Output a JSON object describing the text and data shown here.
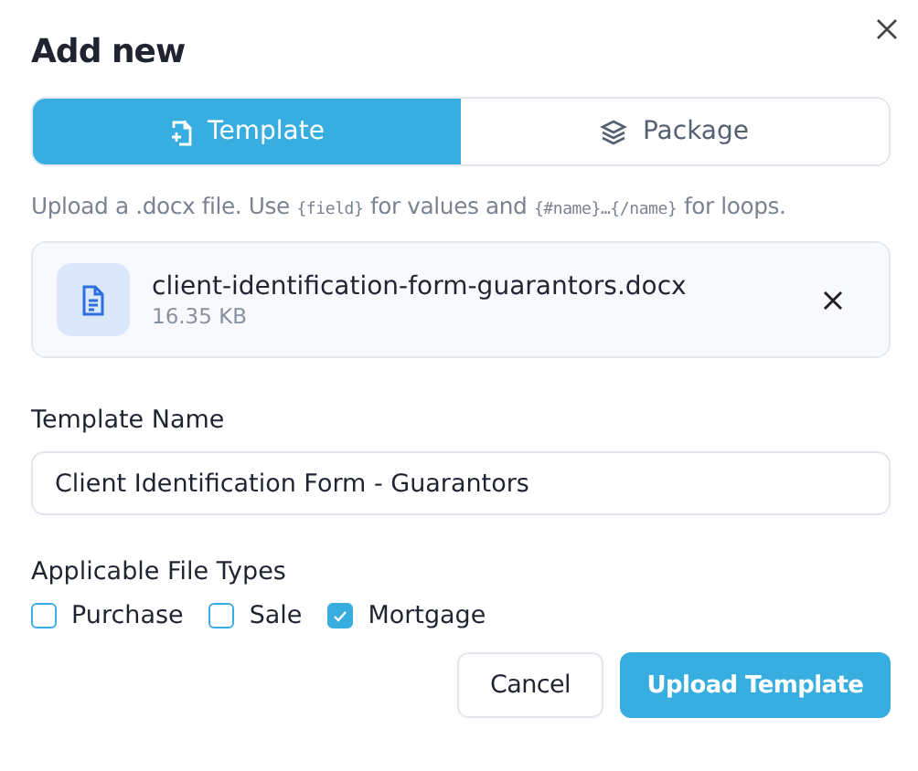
{
  "dialog": {
    "title": "Add new"
  },
  "tabs": [
    {
      "label": "Template",
      "selected": true
    },
    {
      "label": "Package",
      "selected": false
    }
  ],
  "hint": [
    {
      "kind": "text",
      "text": "Upload a .docx file. Use "
    },
    {
      "kind": "code",
      "text": "{field}"
    },
    {
      "kind": "text",
      "text": " for values and "
    },
    {
      "kind": "code",
      "text": "{#name}…{/name}"
    },
    {
      "kind": "text",
      "text": " for loops."
    }
  ],
  "file": {
    "name": "client-identification-form-guarantors.docx",
    "size": "16.35 KB"
  },
  "name_field": {
    "label": "Template Name",
    "value": "Client Identification Form - Guarantors"
  },
  "file_types": {
    "label": "Applicable File Types",
    "options": [
      {
        "label": "Purchase",
        "checked": false
      },
      {
        "label": "Sale",
        "checked": false
      },
      {
        "label": "Mortgage",
        "checked": true
      }
    ]
  },
  "buttons": [
    {
      "label": "Cancel",
      "kind": "secondary"
    },
    {
      "label": "Upload Template",
      "kind": "primary"
    }
  ]
}
